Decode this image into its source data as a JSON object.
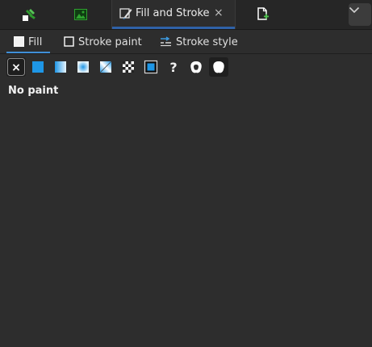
{
  "dock": {
    "active_tab_title": "Fill and Stroke",
    "close_glyph": "×",
    "icons": [
      "tools-icon",
      "image-icon",
      "fill-stroke-icon",
      "new-document-icon",
      "chevron-down-icon"
    ]
  },
  "subtabs": {
    "fill": "Fill",
    "stroke_paint": "Stroke paint",
    "stroke_style": "Stroke style"
  },
  "paint_modes": {
    "none_glyph": "×",
    "unset_glyph": "?"
  },
  "status": "No paint",
  "colors": {
    "accent_blue": "#1e96e6",
    "tab_underline": "#2f62a8",
    "panel_bg": "#2d2d2d"
  }
}
